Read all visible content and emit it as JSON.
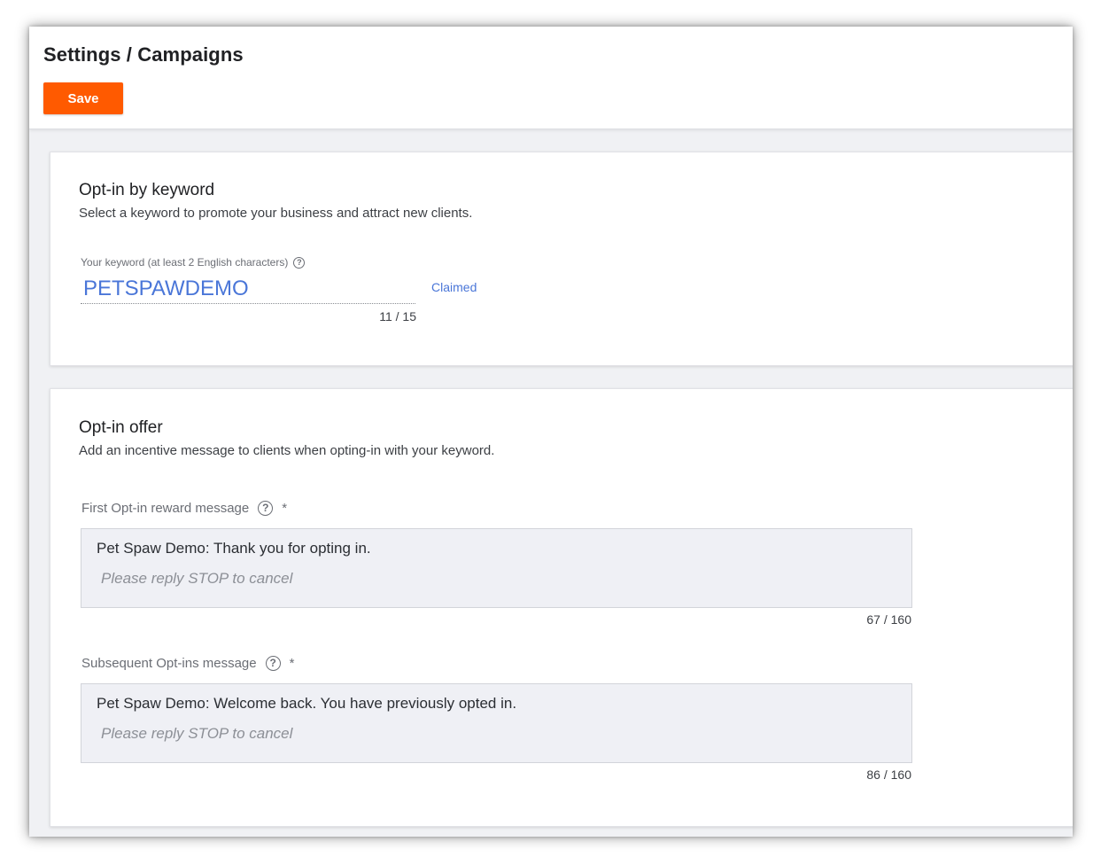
{
  "header": {
    "title": "Settings / Campaigns",
    "save_label": "Save",
    "accent_color": "#ff5a00"
  },
  "keyword_section": {
    "title": "Opt-in by keyword",
    "subtitle": "Select a keyword to promote your business and attract new clients.",
    "field_label": "Your keyword (at least 2 English characters)",
    "help_icon": "help-circle-icon",
    "value": "PETSPAWDEMO",
    "status": "Claimed",
    "counter": "11 / 15"
  },
  "offer_section": {
    "title": "Opt-in offer",
    "subtitle": "Add an incentive message to clients when opting-in with your keyword.",
    "fields": [
      {
        "label": "First Opt-in reward message",
        "required_mark": "*",
        "message": "Pet Spaw Demo: Thank you for opting in.",
        "suffix": "Please reply STOP to cancel",
        "counter": "67 / 160"
      },
      {
        "label": "Subsequent Opt-ins message",
        "required_mark": "*",
        "message": "Pet Spaw Demo: Welcome back. You have previously opted in.",
        "suffix": "Please reply STOP to cancel",
        "counter": "86 / 160"
      }
    ]
  }
}
